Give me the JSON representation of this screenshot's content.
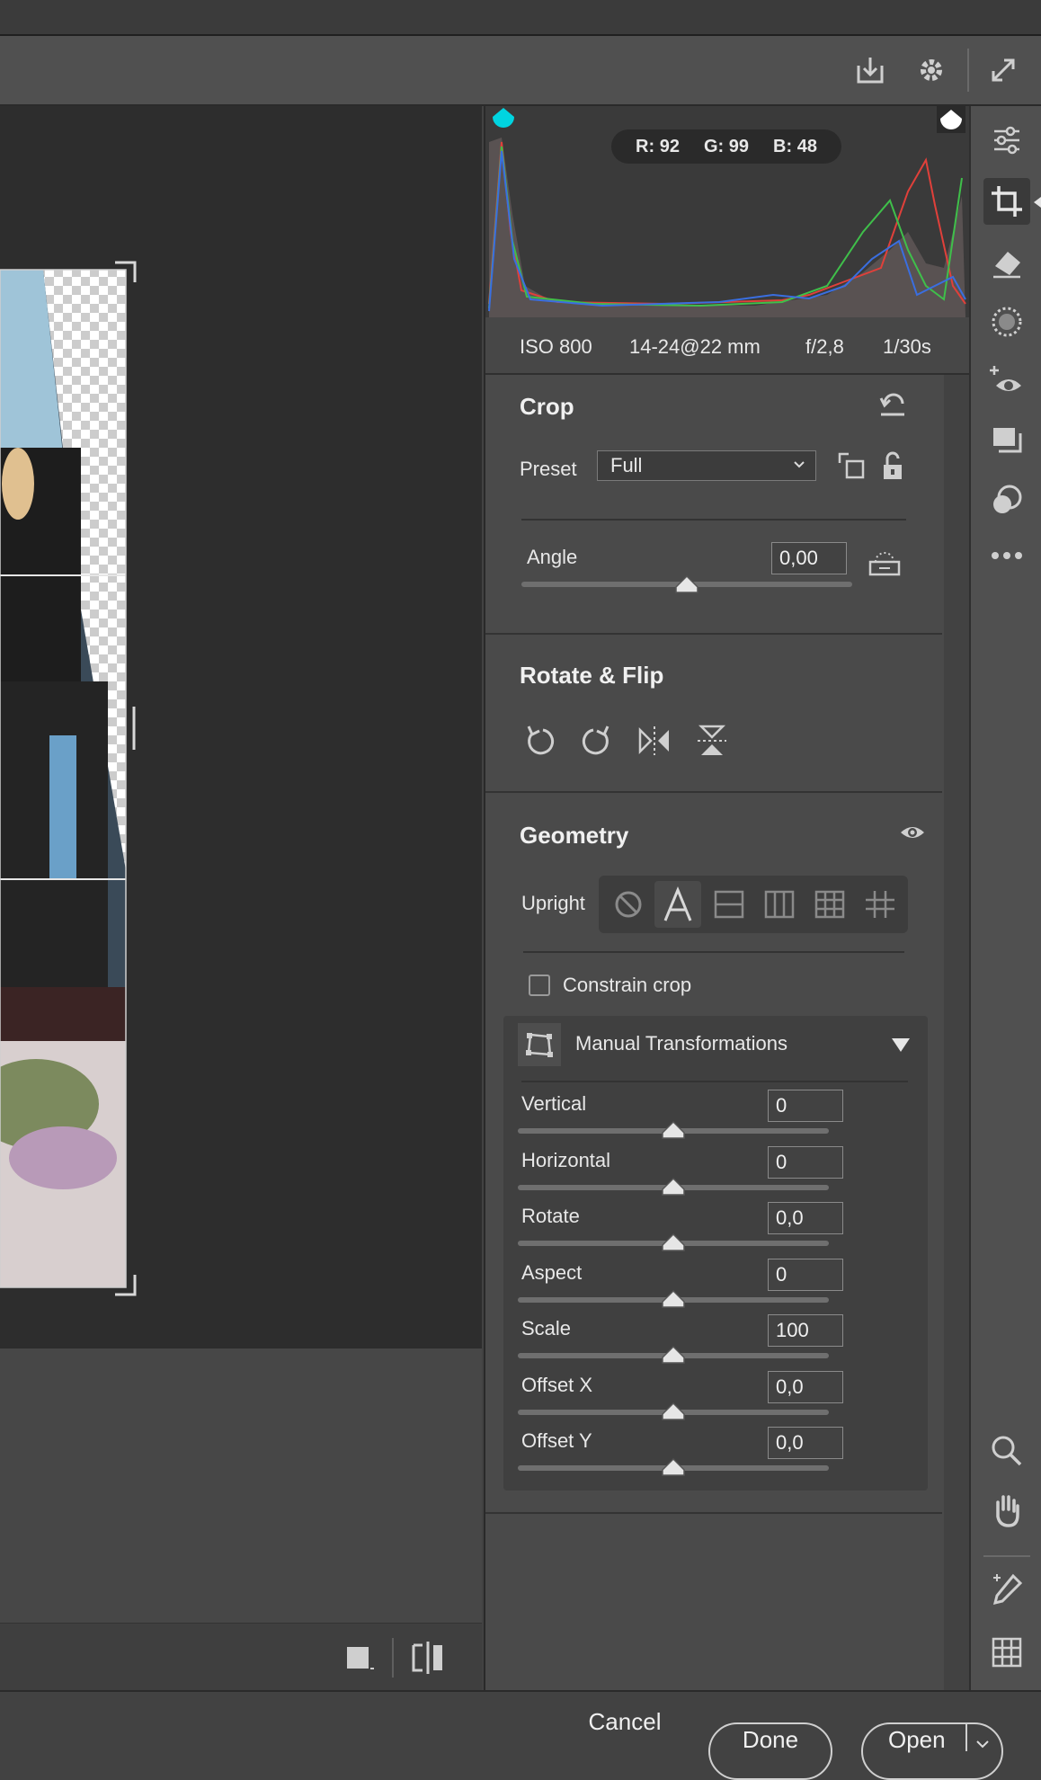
{
  "histogram": {
    "r_label": "R:",
    "r": "92",
    "g_label": "G:",
    "g": "99",
    "b_label": "B:",
    "b": "48"
  },
  "exif": {
    "iso": "ISO 800",
    "lens": "14-24@22 mm",
    "aperture": "f/2,8",
    "shutter": "1/30s"
  },
  "crop": {
    "title": "Crop",
    "preset_label": "Preset",
    "preset_value": "Full",
    "angle_label": "Angle",
    "angle_value": "0,00",
    "angle_slider": 0.5
  },
  "rotate_flip": {
    "title": "Rotate & Flip"
  },
  "geometry": {
    "title": "Geometry",
    "upright_label": "Upright",
    "constrain_label": "Constrain crop",
    "constrain_checked": false,
    "manual_title": "Manual Transformations",
    "sliders": [
      {
        "label": "Vertical",
        "value": "0",
        "pos": 0.5
      },
      {
        "label": "Horizontal",
        "value": "0",
        "pos": 0.5
      },
      {
        "label": "Rotate",
        "value": "0,0",
        "pos": 0.5
      },
      {
        "label": "Aspect",
        "value": "0",
        "pos": 0.5
      },
      {
        "label": "Scale",
        "value": "100",
        "pos": 0.5
      },
      {
        "label": "Offset X",
        "value": "0,0",
        "pos": 0.5
      },
      {
        "label": "Offset Y",
        "value": "0,0",
        "pos": 0.5
      }
    ]
  },
  "buttons": {
    "cancel": "Cancel",
    "done": "Done",
    "open": "Open"
  },
  "colors": {
    "accent_cyan": "#00d4e0",
    "hist_red": "#e0403a",
    "hist_green": "#3fbf4a",
    "hist_blue": "#3a6ee0"
  }
}
